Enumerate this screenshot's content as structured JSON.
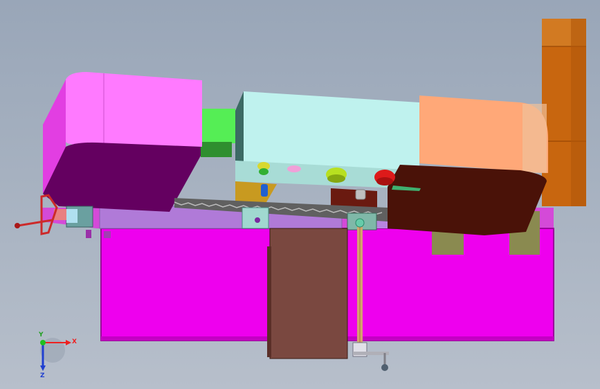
{
  "viewport": {
    "background_top": "#99a6b8",
    "background_bottom": "#b7bfcb"
  },
  "colors": {
    "base_magenta": "#ee00ee",
    "base_magenta_light": "#f060f0",
    "base_edge": "#9a009a",
    "slab_lilac": "#b07ad8",
    "left_wheel_cover": "#ff7aff",
    "left_wheel_cover_dark": "#640060",
    "right_wheel_cover": "#ffa878",
    "right_wheel_cover_dark": "#4a1208",
    "saw_head_cyan": "#bff2ee",
    "saw_head_side": "#3c6a64",
    "green_block": "#55ee55",
    "motor_orange": "#c8660f",
    "column_brown": "#7a4840",
    "saw_blade": "#606060",
    "vise_gold": "#c89a20",
    "vise_maroon": "#6a1a10",
    "olive_leg": "#8a8a50",
    "handwheel_red": "#cc2a2a",
    "lead_screw_tan": "#d6a070"
  },
  "parts": [
    {
      "name": "base-cabinet",
      "icon": "cabinet-icon"
    },
    {
      "name": "left-wheel-cover",
      "icon": "wheel-guard-icon"
    },
    {
      "name": "right-wheel-cover",
      "icon": "wheel-guard-icon"
    },
    {
      "name": "saw-head",
      "icon": "saw-head-icon"
    },
    {
      "name": "drive-motor",
      "icon": "motor-icon"
    },
    {
      "name": "saw-blade",
      "icon": "saw-blade-icon"
    },
    {
      "name": "support-column",
      "icon": "column-icon"
    },
    {
      "name": "feed-lead-screw",
      "icon": "lead-screw-icon"
    },
    {
      "name": "front-handwheel",
      "icon": "handwheel-icon"
    },
    {
      "name": "left-handwheel",
      "icon": "handwheel-icon"
    }
  ],
  "knobs": [
    {
      "name": "knob-yellow",
      "color": "#d8d830"
    },
    {
      "name": "knob-pink",
      "color": "#f0a0d8"
    },
    {
      "name": "knob-lime",
      "color": "#b8e020"
    },
    {
      "name": "knob-red",
      "color": "#dd1a1a"
    },
    {
      "name": "knob-blue",
      "color": "#2060d0"
    }
  ],
  "triad": {
    "x_label": "X",
    "y_label": "Y",
    "z_label": "Z",
    "x_color": "#ee2020",
    "y_color": "#20c020",
    "z_color": "#2040d0"
  }
}
